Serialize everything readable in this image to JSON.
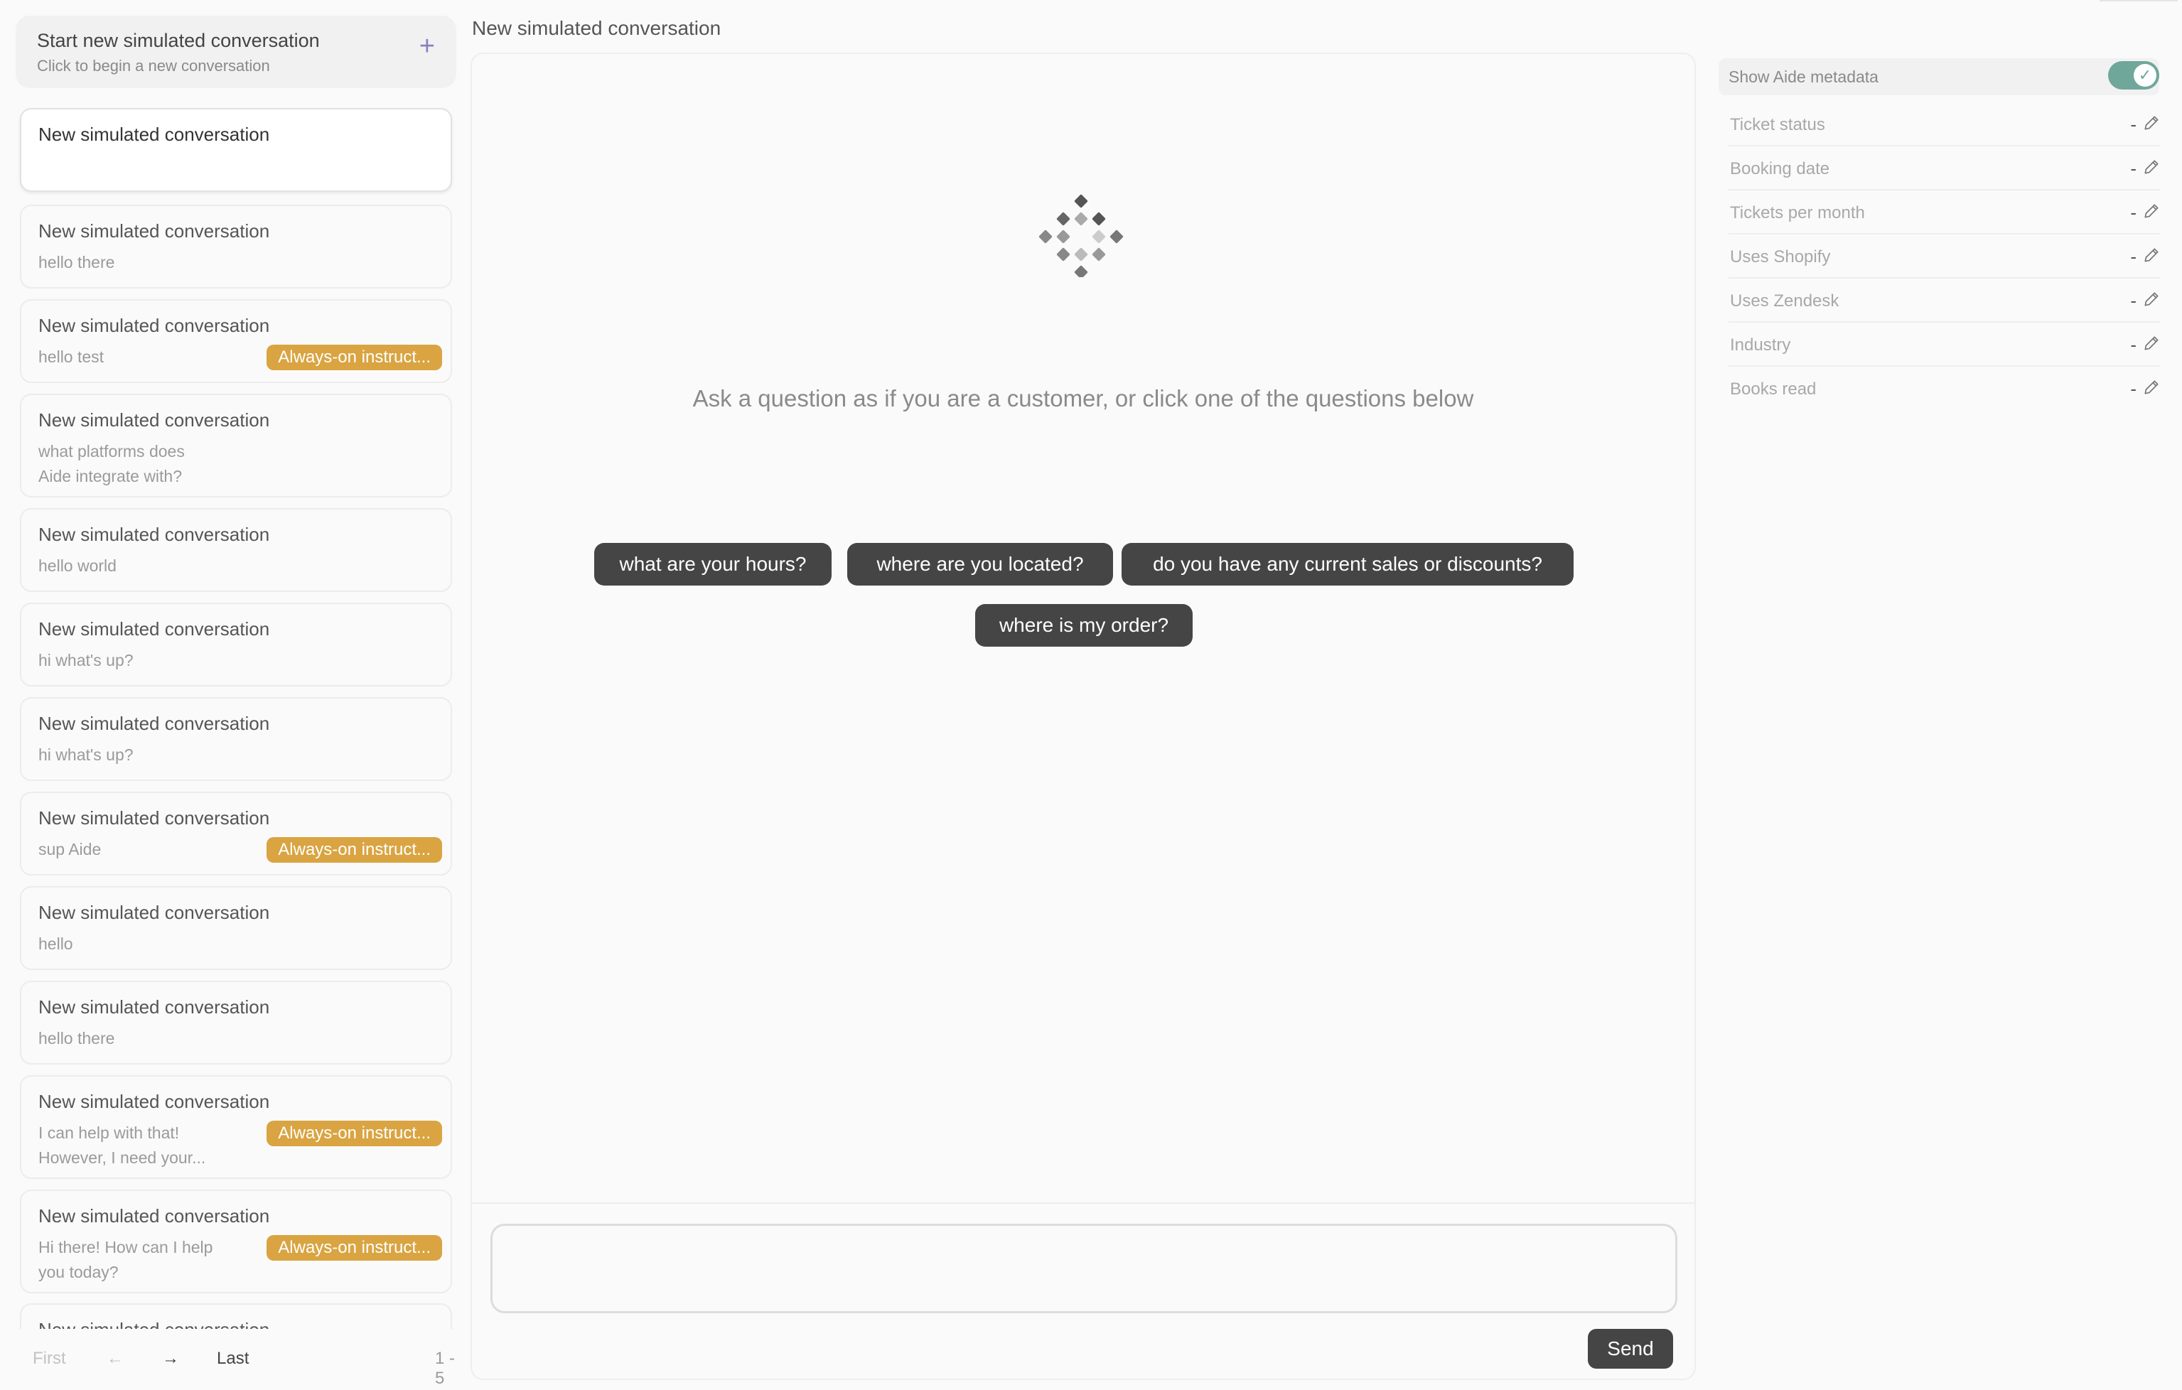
{
  "sidebar": {
    "new_conversation": {
      "title": "Start new simulated conversation",
      "subtitle": "Click to begin a new conversation",
      "icon": "plus-icon"
    },
    "conversations": [
      {
        "title": "New simulated conversation",
        "preview": "",
        "badge": ""
      },
      {
        "title": "New simulated conversation",
        "preview": "hello there",
        "badge": ""
      },
      {
        "title": "New simulated conversation",
        "preview": "hello test",
        "badge": "Always-on instruct..."
      },
      {
        "title": "New simulated conversation",
        "preview": "what platforms does\nAide integrate with?",
        "badge": ""
      },
      {
        "title": "New simulated conversation",
        "preview": "hello world",
        "badge": ""
      },
      {
        "title": "New simulated conversation",
        "preview": "hi what's up?",
        "badge": ""
      },
      {
        "title": "New simulated conversation",
        "preview": "hi what's up?",
        "badge": ""
      },
      {
        "title": "New simulated conversation",
        "preview": "sup Aide",
        "badge": "Always-on instruct..."
      },
      {
        "title": "New simulated conversation",
        "preview": "hello",
        "badge": ""
      },
      {
        "title": "New simulated conversation",
        "preview": "hello there",
        "badge": ""
      },
      {
        "title": "New simulated conversation",
        "preview": "I can help with that!\nHowever, I need your...",
        "badge": "Always-on instruct..."
      },
      {
        "title": "New simulated conversation",
        "preview": "Hi there! How can I help\nyou today?",
        "badge": "Always-on instruct..."
      },
      {
        "title": "New simulated conversation",
        "preview": "",
        "badge": ""
      }
    ],
    "pagination": {
      "first": "First",
      "prev": "←",
      "next": "→",
      "last": "Last",
      "range": "1 - 5"
    }
  },
  "main": {
    "title": "New simulated conversation",
    "prompt": "Ask a question as if you are a customer, or click one of the questions below",
    "suggestions": [
      "what are your hours?",
      "where are you located?",
      "do you have any current sales or discounts?",
      "where is my order?"
    ],
    "composer_placeholder": "",
    "send_label": "Send"
  },
  "metadata_panel": {
    "toggle_label": "Show Aide metadata",
    "toggle_on": true,
    "fields": [
      {
        "key": "Ticket status",
        "value": "-"
      },
      {
        "key": "Booking date",
        "value": "-"
      },
      {
        "key": "Tickets per month",
        "value": "-"
      },
      {
        "key": "Uses Shopify",
        "value": "-"
      },
      {
        "key": "Uses Zendesk",
        "value": "-"
      },
      {
        "key": "Industry",
        "value": "-"
      },
      {
        "key": "Books read",
        "value": "-"
      }
    ]
  },
  "colors": {
    "badge": "#d9a441",
    "chip": "#454545",
    "toggle": "#6fa79a",
    "plus": "#8a7fc0"
  }
}
